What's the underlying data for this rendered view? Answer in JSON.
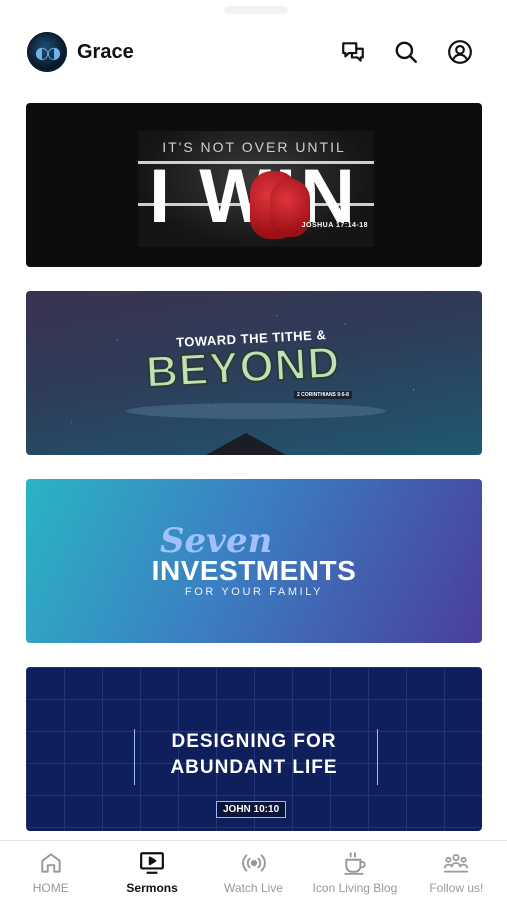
{
  "header": {
    "logo_icon": "church-logo-icon",
    "title": "Grace",
    "icons": [
      "chat-icon",
      "search-icon",
      "profile-icon"
    ]
  },
  "sermons": [
    {
      "top_text": "IT'S NOT OVER UNTIL",
      "main_text": "I WIN",
      "reference": "JOSHUA 17:14-18"
    },
    {
      "top_text": "TOWARD THE TITHE &",
      "main_text": "BEYOND",
      "reference": "2 CORINTHIANS 9:6-8"
    },
    {
      "script_text": "Seven",
      "main_text": "INVESTMENTS",
      "subtitle": "FOR YOUR FAMILY"
    },
    {
      "line1": "DESIGNING FOR",
      "line2": "ABUNDANT LIFE",
      "reference": "JOHN 10:10"
    }
  ],
  "tabbar": {
    "active": "Sermons",
    "tabs": [
      {
        "label": "HOME",
        "icon": "home-icon"
      },
      {
        "label": "Sermons",
        "icon": "tv-play-icon"
      },
      {
        "label": "Watch Live",
        "icon": "live-broadcast-icon"
      },
      {
        "label": "Icon Living Blog",
        "icon": "coffee-cup-icon"
      },
      {
        "label": "Follow us!",
        "icon": "people-group-icon"
      }
    ]
  },
  "colors": {
    "accent": "#111111",
    "inactive_tab": "#999999",
    "card_1_bg": "#0d0d0d",
    "card_2_bg": "#2d3d5a",
    "card_3_bg": "#3b7fc2",
    "card_4_bg": "#0f1f5c"
  }
}
